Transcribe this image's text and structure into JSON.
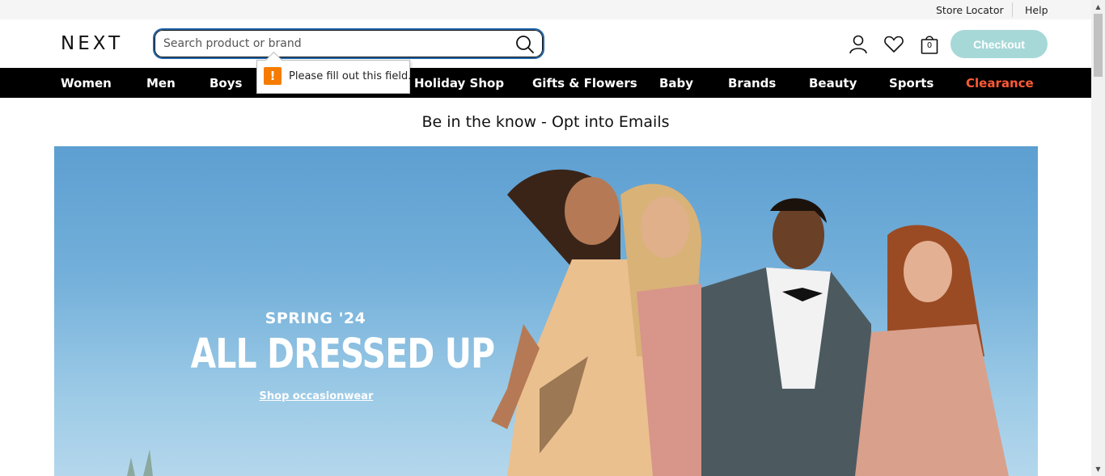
{
  "utility": {
    "store_locator": "Store Locator",
    "help": "Help"
  },
  "header": {
    "logo": "NEXT",
    "search": {
      "placeholder": "Search product or brand",
      "value": ""
    },
    "validation_tooltip": "Please fill out this field.",
    "bag_count": "0",
    "checkout_label": "Checkout",
    "icons": [
      "user-icon",
      "heart-icon",
      "bag-icon",
      "search-icon"
    ]
  },
  "nav": {
    "items": [
      "Women",
      "Men",
      "Boys",
      "Holiday Shop",
      "Gifts & Flowers",
      "Baby",
      "Brands",
      "Beauty",
      "Sports",
      "Clearance"
    ],
    "highlight_color": "#ff5a36"
  },
  "promo": {
    "text": "Be in the know - Opt into Emails"
  },
  "hero": {
    "eyebrow": "SPRING '24",
    "title": "ALL DRESSED UP",
    "link": "Shop occasionwear"
  },
  "colors": {
    "checkout_bg": "#a7d8d8",
    "search_border": "#2266aa",
    "nav_bg": "#000000",
    "warning": "#f57c00"
  }
}
